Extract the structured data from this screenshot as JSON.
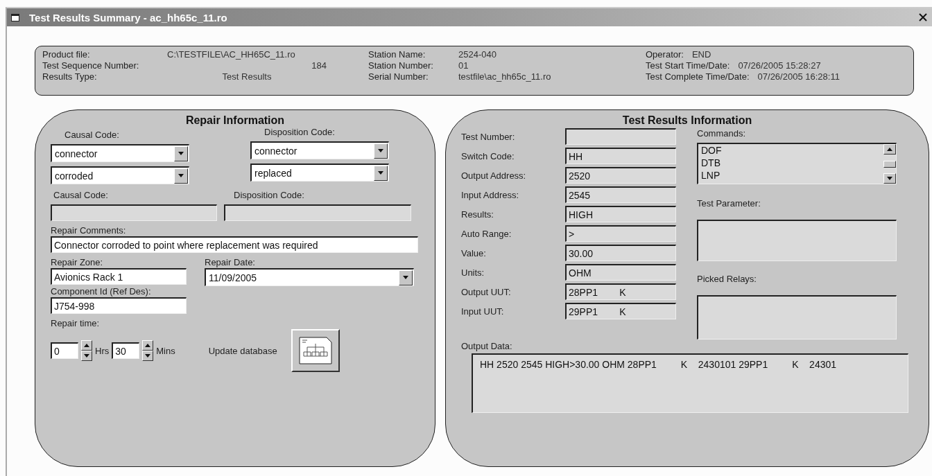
{
  "window": {
    "title": "Test Results Summary - ac_hh65c_11.ro"
  },
  "header": {
    "columns": [
      [
        {
          "label": "Product file:",
          "value": "C:\\TESTFILE\\AC_HH65C_11.ro"
        },
        {
          "label": "Test Sequence Number:",
          "value": "184"
        },
        {
          "label": "Results Type:",
          "value": "Test Results"
        }
      ],
      [
        {
          "label": "Station Name:",
          "value": "2524-040"
        },
        {
          "label": "Station Number:",
          "value": "01"
        },
        {
          "label": "Serial Number:",
          "value": "testfile\\ac_hh65c_11.ro"
        }
      ],
      [
        {
          "label": "Operator:",
          "value": "END"
        },
        {
          "label": "Test Start Time/Date:",
          "value": "07/26/2005 15:28:27"
        },
        {
          "label": "Test Complete Time/Date:",
          "value": "07/26/2005 16:28:11"
        }
      ]
    ]
  },
  "repair": {
    "title": "Repair Information",
    "code_columns": [
      {
        "label": "Causal Code:",
        "selects": [
          "connector",
          "corroded"
        ]
      },
      {
        "label": "Disposition Code:",
        "selects": [
          "connector",
          "replaced"
        ]
      }
    ],
    "code_fields": [
      {
        "label": "Causal Code:"
      },
      {
        "label": "Disposition Code:"
      }
    ],
    "comments": {
      "label": "Repair Comments:",
      "value": "Connector corroded to point where replacement was required"
    },
    "zone": {
      "label": "Repair Zone:",
      "value": "Avionics Rack 1"
    },
    "date": {
      "label": "Repair Date:",
      "value": "11/09/2005"
    },
    "component": {
      "label": "Component Id (Ref Des):",
      "value": "J754-998"
    },
    "repair_time": {
      "label": "Repair time:",
      "hours": "0",
      "hours_unit": "Hrs",
      "minutes": "30",
      "minutes_unit": "Mins"
    },
    "update_label": "Update database"
  },
  "results": {
    "title": "Test Results Information",
    "fields": [
      {
        "label": "Test Number:"
      },
      {
        "label": "Switch Code:",
        "value": "HH"
      },
      {
        "label": "Output Address:",
        "value": "2520"
      },
      {
        "label": "Input Address:",
        "value": "2545"
      },
      {
        "label": "Results:",
        "value": "HIGH"
      },
      {
        "label": "Auto Range:",
        "value": ">"
      },
      {
        "label": "Value:",
        "value": "30.00"
      },
      {
        "label": "Units:",
        "value": "OHM"
      },
      {
        "label": "Output UUT:",
        "value": "28PP1        K"
      },
      {
        "label": "Input UUT:",
        "value": "29PP1        K"
      }
    ],
    "commands": {
      "label": "Commands:",
      "items": [
        "DOF",
        "DTB",
        "LNP"
      ]
    },
    "test_parameter": {
      "label": "Test Parameter:"
    },
    "picked_relays": {
      "label": "Picked Relays:"
    },
    "output_data": {
      "label": "Output Data:",
      "value": "HH 2520 2545 HIGH>30.00 OHM 28PP1         K    2430101 29PP1         K    24301"
    }
  }
}
